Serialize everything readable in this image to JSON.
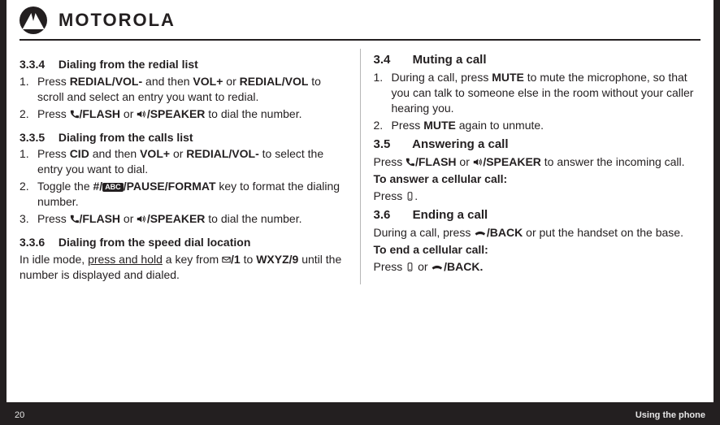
{
  "brand": {
    "wordmark": "MOTOROLA"
  },
  "left": {
    "s334": {
      "num": "3.3.4",
      "title": "Dialing from the redial list",
      "items": [
        {
          "n": "1.",
          "prefix": "Press ",
          "b1": "REDIAL/VOL-",
          "mid1": " and then ",
          "b2": "VOL+",
          "mid2": " or ",
          "b3": "REDIAL/VOL",
          "suffix": " to scroll and select an entry you want to redial."
        },
        {
          "n": "2.",
          "prefix": "Press ",
          "b1": "/FLASH",
          "mid1": " or ",
          "b2": "/SPEAKER",
          "suffix": " to dial the number."
        }
      ]
    },
    "s335": {
      "num": "3.3.5",
      "title": "Dialing from the calls list",
      "items": [
        {
          "n": "1.",
          "prefix": "Press ",
          "b1": "CID",
          "mid1": " and then ",
          "b2": "VOL+",
          "mid2": " or ",
          "b3": "REDIAL/VOL-",
          "suffix": " to select the entry you want to dial."
        },
        {
          "n": "2.",
          "prefix": "Toggle the ",
          "b1": "#/",
          "abc": "ABC",
          "b2": "/PAUSE/FORMAT",
          "suffix": " key to format the dialing number."
        },
        {
          "n": "3.",
          "prefix": "Press ",
          "b1": "/FLASH",
          "mid1": " or ",
          "b2": "/SPEAKER",
          "suffix": " to dial the number."
        }
      ]
    },
    "s336": {
      "num": "3.3.6",
      "title": "Dialing from the speed dial location",
      "p_prefix": "In idle mode, ",
      "p_u": "press and hold",
      "p_mid1": " a key from ",
      "p_b1": "/1",
      "p_mid2": " to ",
      "p_b2": "WXYZ/9",
      "p_suffix": " until the number is displayed and dialed."
    }
  },
  "right": {
    "s34": {
      "num": "3.4",
      "title": "Muting a call",
      "items": [
        {
          "n": "1.",
          "prefix": "During a call, press ",
          "b1": "MUTE",
          "suffix": " to mute the microphone, so that you can talk to someone else in the room without your caller hearing you."
        },
        {
          "n": "2.",
          "prefix": "Press ",
          "b1": "MUTE",
          "suffix": " again to unmute."
        }
      ]
    },
    "s35": {
      "num": "3.5",
      "title": "Answering a call",
      "p_prefix": "Press ",
      "p_b1": "/FLASH",
      "p_mid1": " or ",
      "p_b2": "/SPEAKER",
      "p_suffix": " to answer the incoming call.",
      "sub_b": "To answer a cellular call:",
      "sub_p_prefix": "Press ",
      "sub_p_suffix": "."
    },
    "s36": {
      "num": "3.6",
      "title": "Ending a call",
      "p_prefix": "During a call, press ",
      "p_b1": "/BACK",
      "p_suffix": " or put the handset on the base.",
      "sub_b": "To end a cellular call:",
      "sub_p_prefix": "Press ",
      "sub_p_mid": " or ",
      "sub_p_b1": "/BACK.",
      "sub_p_suffix": ""
    }
  },
  "footer": {
    "page": "20",
    "title": "Using the phone"
  }
}
